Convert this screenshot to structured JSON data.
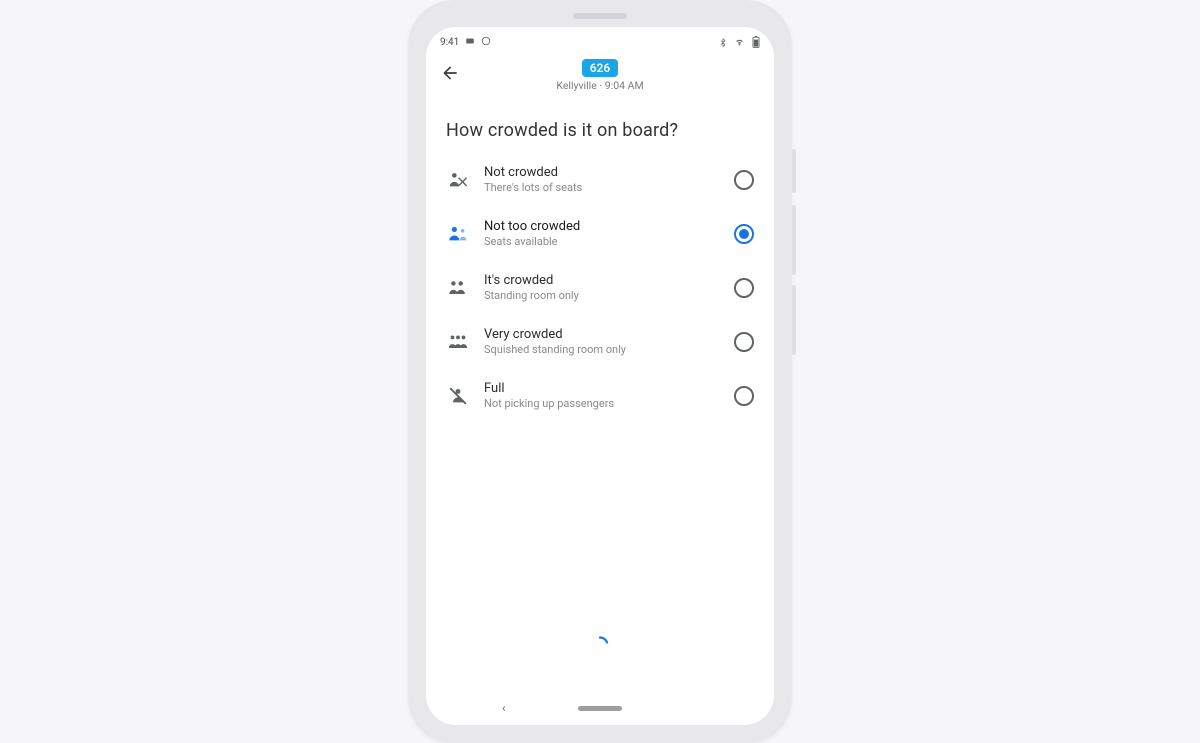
{
  "status": {
    "time": "9:41"
  },
  "header": {
    "route_number": "626",
    "destination": "Kellyville",
    "separator": " · ",
    "time": "9:04 AM"
  },
  "question": "How crowded is it on board?",
  "selected_index": 1,
  "options": [
    {
      "title": "Not crowded",
      "subtitle": "There's lots of seats"
    },
    {
      "title": "Not too crowded",
      "subtitle": "Seats available"
    },
    {
      "title": "It's crowded",
      "subtitle": "Standing room only"
    },
    {
      "title": "Very crowded",
      "subtitle": "Squished standing room only"
    },
    {
      "title": "Full",
      "subtitle": "Not picking up passengers"
    }
  ],
  "colors": {
    "accent": "#1a73e8",
    "route_pill": "#1aa6e6"
  }
}
